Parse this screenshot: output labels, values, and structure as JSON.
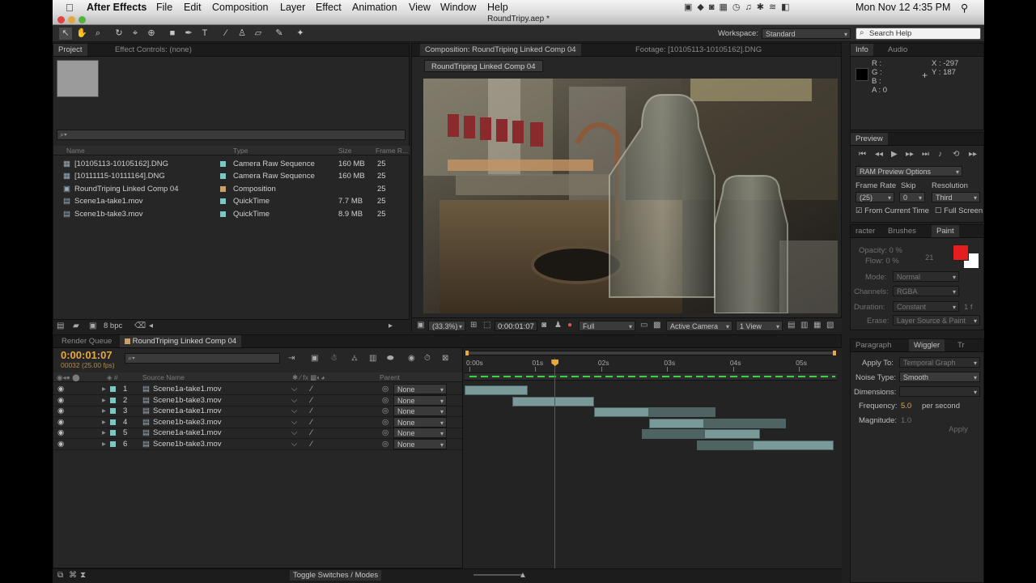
{
  "menubar": {
    "apple_icon": "apple-icon",
    "app_name": "After Effects",
    "items": [
      "File",
      "Edit",
      "Composition",
      "Layer",
      "Effect",
      "Animation",
      "View",
      "Window",
      "Help"
    ],
    "clock": "Mon Nov 12  4:35 PM"
  },
  "window": {
    "title": "RoundTripy.aep *"
  },
  "toolbar": {
    "workspace_label": "Workspace:",
    "workspace_value": "Standard",
    "search_placeholder": "Search Help"
  },
  "project": {
    "tabs": [
      "Project",
      "Effect Controls: (none)"
    ],
    "columns": [
      "Name",
      "Type",
      "Size",
      "Frame R..."
    ],
    "items": [
      {
        "name": "[10105113-10105162].DNG",
        "type": "Camera Raw Sequence",
        "size": "160 MB",
        "fps": "25",
        "color": "#7fc6c0"
      },
      {
        "name": "[10111115-10111164].DNG",
        "type": "Camera Raw Sequence",
        "size": "160 MB",
        "fps": "25",
        "color": "#7fc6c0"
      },
      {
        "name": "RoundTriping Linked Comp 04",
        "type": "Composition",
        "size": "",
        "fps": "25",
        "color": "#c8a06a"
      },
      {
        "name": "Scene1a-take1.mov",
        "type": "QuickTime",
        "size": "7.7 MB",
        "fps": "25",
        "color": "#7fc6c0"
      },
      {
        "name": "Scene1b-take3.mov",
        "type": "QuickTime",
        "size": "8.9 MB",
        "fps": "25",
        "color": "#7fc6c0"
      }
    ],
    "bpc": "8 bpc"
  },
  "composition": {
    "tabs": [
      "Composition: RoundTriping Linked Comp 04",
      "Footage: [10105113-10105162].DNG"
    ],
    "comp_button": "RoundTriping Linked Comp 04",
    "zoom": "(33.3%)",
    "timecode": "0:00:01:07",
    "resolution": "Full",
    "camera": "Active Camera",
    "views": "1 View"
  },
  "info": {
    "tabs": [
      "Info",
      "Audio"
    ],
    "r": "R :",
    "g": "G :",
    "b": "B :",
    "a": "A : 0",
    "x": "X : -297",
    "y": "Y : 187"
  },
  "preview": {
    "tab": "Preview",
    "ram_options": "RAM Preview Options",
    "frame_rate_label": "Frame Rate",
    "skip_label": "Skip",
    "resolution_label": "Resolution",
    "frame_rate": "(25)",
    "skip": "0",
    "resolution": "Third",
    "from_current_time": "From Current Time",
    "full_screen": "Full Screen"
  },
  "paint": {
    "tabs": [
      "racter",
      "Brushes",
      "Paint"
    ],
    "opacity": "Opacity: 0 %",
    "flow": "Flow: 0 %",
    "brush_size": "21",
    "mode_label": "Mode:",
    "mode": "Normal",
    "channels_label": "Channels:",
    "channels": "RGBA",
    "duration_label": "Duration:",
    "duration": "Constant",
    "duration_frames": "1  f",
    "erase_label": "Erase:",
    "erase": "Layer Source & Paint",
    "fg_color": "#e41e1e"
  },
  "wiggler": {
    "tabs": [
      "Paragraph",
      "Wiggler",
      "Tr"
    ],
    "apply_to_label": "Apply To:",
    "apply_to": "Temporal Graph",
    "noise_label": "Noise Type:",
    "noise": "Smooth",
    "dimensions_label": "Dimensions:",
    "frequency_label": "Frequency:",
    "frequency": "5.0",
    "frequency_unit": "per second",
    "magnitude_label": "Magnitude:",
    "magnitude": "1.0",
    "apply_button": "Apply"
  },
  "timeline": {
    "tabs": [
      "Render Queue",
      "RoundTriping Linked Comp 04"
    ],
    "timecode": "0:00:01:07",
    "frame_info": "00032 (25.00 fps)",
    "col_source": "Source Name",
    "col_parent": "Parent",
    "ruler": [
      "0:00s",
      "01s",
      "02s",
      "03s",
      "04s",
      "05s"
    ],
    "playhead_fraction": 0.242,
    "toggle_label": "Toggle Switches / Modes",
    "layers": [
      {
        "num": "1",
        "name": "Scene1a-take1.mov",
        "parent": "None",
        "start": 0.0,
        "end": 0.17,
        "ghost_end": 0.17
      },
      {
        "num": "2",
        "name": "Scene1b-take3.mov",
        "parent": "None",
        "start": 0.13,
        "end": 0.35,
        "ghost_end": 0.35
      },
      {
        "num": "3",
        "name": "Scene1a-take1.mov",
        "parent": "None",
        "start": 0.35,
        "end": 0.5,
        "ghost_end": 0.68
      },
      {
        "num": "4",
        "name": "Scene1b-take3.mov",
        "parent": "None",
        "start": 0.5,
        "end": 0.65,
        "ghost_end": 0.87
      },
      {
        "num": "5",
        "name": "Scene1a-take1.mov",
        "parent": "None",
        "start": 0.65,
        "end": 0.8,
        "ghost_end": 0.8,
        "ghost_start": 0.48
      },
      {
        "num": "6",
        "name": "Scene1b-take3.mov",
        "parent": "None",
        "start": 0.78,
        "end": 1.0,
        "ghost_start": 0.63
      }
    ]
  }
}
